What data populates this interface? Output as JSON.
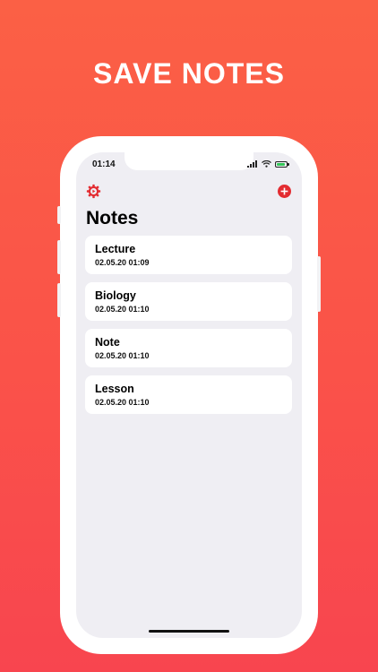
{
  "headline": "SAVE NOTES",
  "status_bar": {
    "time": "01:14",
    "icons": [
      "signal-icon",
      "wifi-icon",
      "battery-icon"
    ]
  },
  "toolbar": {
    "settings_icon": "gear-icon",
    "add_icon": "plus-circle-icon"
  },
  "page": {
    "title": "Notes"
  },
  "notes": [
    {
      "title": "Lecture",
      "date": "02.05.20 01:09"
    },
    {
      "title": "Biology",
      "date": "02.05.20 01:10"
    },
    {
      "title": "Note",
      "date": "02.05.20 01:10"
    },
    {
      "title": "Lesson",
      "date": "02.05.20 01:10"
    }
  ],
  "colors": {
    "accent": "#e32c31",
    "background_top": "#fb6045",
    "background_bottom": "#f8454f",
    "screen_background": "#efeef3",
    "battery": "#34c759"
  }
}
